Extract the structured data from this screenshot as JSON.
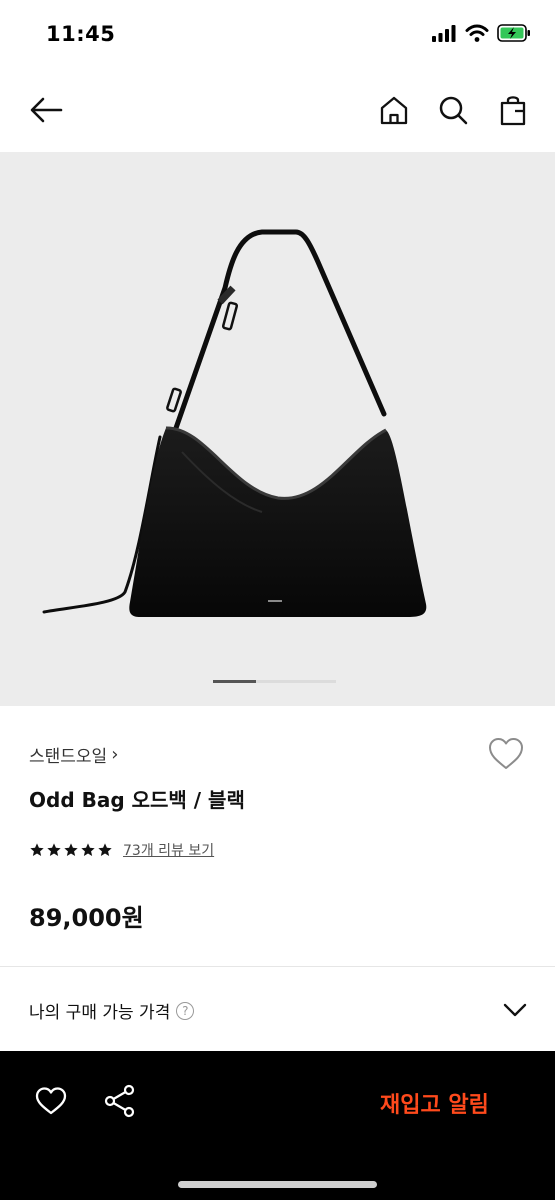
{
  "status_bar": {
    "time": "11:45",
    "icons": [
      "signal-icon",
      "wifi-icon",
      "battery-charging-icon"
    ]
  },
  "nav": {
    "icons": [
      "back-arrow-icon",
      "home-icon",
      "search-icon",
      "shopping-bag-icon"
    ]
  },
  "gallery": {
    "active_index": 0,
    "brand_mark": "STAND OIL"
  },
  "product": {
    "brand": "스탠드오일",
    "brand_chevron": "›",
    "title": "Odd Bag 오드백 / 블랙",
    "rating": 5,
    "review_link": "73개 리뷰 보기",
    "price": "89,000원"
  },
  "my_price": {
    "label": "나의 구매 가능 가격",
    "help": "?"
  },
  "bottom_bar": {
    "restock_label": "재입고 알림",
    "accent": "#ff4a1c",
    "icons": [
      "heart-icon",
      "share-icon"
    ]
  }
}
